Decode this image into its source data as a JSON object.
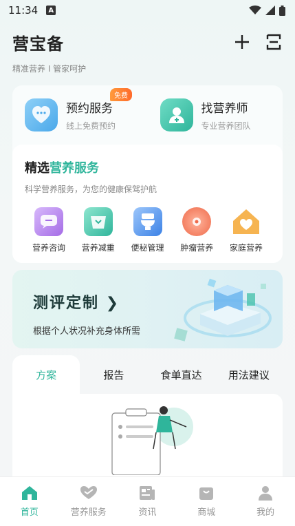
{
  "status": {
    "time": "11:34",
    "notif_badge": "A"
  },
  "header": {
    "title": "营宝备",
    "subtitle": "精准营养 I 管家呵护"
  },
  "top_services": [
    {
      "title": "预约服务",
      "sub": "线上免费预约",
      "icon": "chat-heart-icon",
      "badge": "免费"
    },
    {
      "title": "找营养师",
      "sub": "专业营养团队",
      "icon": "nutritionist-icon"
    }
  ],
  "selected": {
    "title_prefix": "精选",
    "title_accent": "营养服务",
    "subtitle": "科学营养服务，为您的健康保驾护航",
    "categories": [
      {
        "label": "营养咨询",
        "icon": "consult-icon",
        "color": "#b07ae8"
      },
      {
        "label": "营养减重",
        "icon": "weight-loss-icon",
        "color": "#3cc4a5"
      },
      {
        "label": "便秘管理",
        "icon": "toilet-icon",
        "color": "#4a90ea"
      },
      {
        "label": "肿瘤营养",
        "icon": "tumor-icon",
        "color": "#f07a5a"
      },
      {
        "label": "家庭营养",
        "icon": "home-heart-icon",
        "color": "#f5b24a"
      }
    ]
  },
  "banner": {
    "title": "测评定制",
    "subtitle": "根据个人状况补充身体所需"
  },
  "tabs": [
    {
      "label": "方案",
      "active": true
    },
    {
      "label": "报告"
    },
    {
      "label": "食单直达"
    },
    {
      "label": "用法建议"
    }
  ],
  "nav": [
    {
      "label": "首页",
      "icon": "home-icon",
      "active": true
    },
    {
      "label": "营养服务",
      "icon": "service-icon"
    },
    {
      "label": "资讯",
      "icon": "news-icon"
    },
    {
      "label": "商城",
      "icon": "shop-icon"
    },
    {
      "label": "我的",
      "icon": "profile-icon"
    }
  ],
  "colors": {
    "accent": "#2fb59b"
  }
}
